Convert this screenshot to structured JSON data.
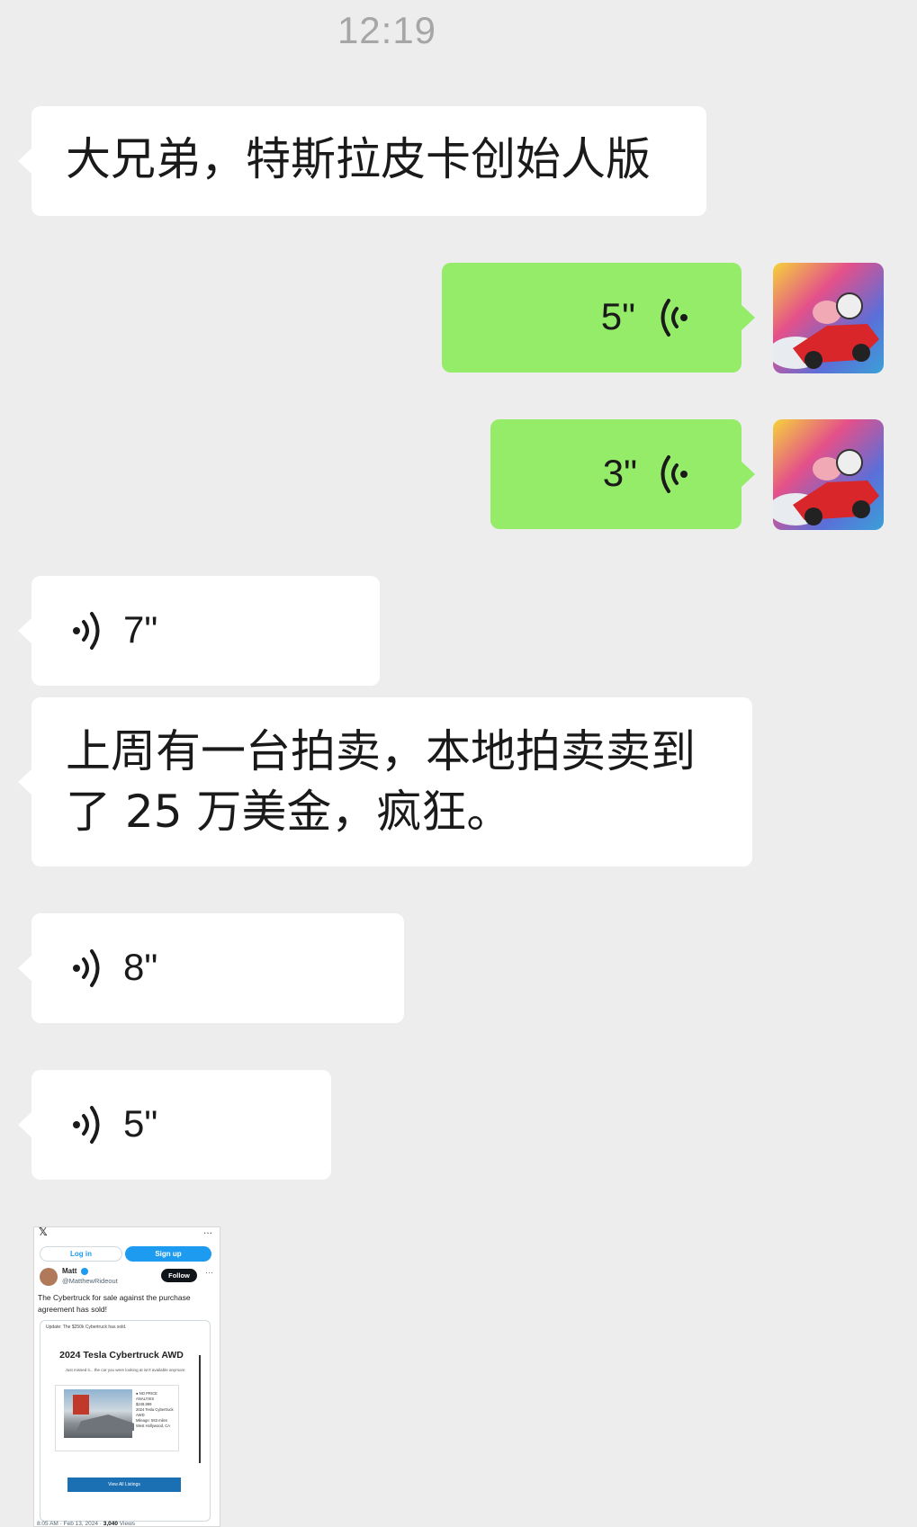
{
  "status": {
    "time": "12:19"
  },
  "messages": {
    "m1": {
      "text": "大兄弟，特斯拉皮卡创始人版"
    },
    "v1": {
      "duration": "5\""
    },
    "v2": {
      "duration": "3\""
    },
    "v3": {
      "duration": "7\""
    },
    "m2": {
      "line1": "上周有一台拍卖，本地拍卖卖到",
      "line2": "了 25 万美金，疯狂。"
    },
    "v4": {
      "duration": "8\""
    },
    "v5": {
      "duration": "5\""
    }
  },
  "screenshot": {
    "x_logo": "𝕏",
    "dots": "...",
    "login": "Log in",
    "signup": "Sign up",
    "user_name": "Matt",
    "user_handle": "@MatthewRideout",
    "follow": "Follow",
    "more": "···",
    "tweet_text": "The Cybertruck for sale against the purchase agreement has sold!",
    "card_update": "Update: The $250k Cybertruck has sold.",
    "card_title": "2024 Tesla Cybertruck AWD",
    "card_sub": "Just missed it... the car you were looking at isn't available anymore",
    "listing_lines": [
      "● NO PRICE ANALYSIS",
      "$249,999",
      "2024 Tesla Cybertruck AWD",
      "Mileage: 553 miles",
      "West Hollywood, CA"
    ],
    "view_all": "View All Listings",
    "meta_time": "8:05 AM · Feb 13, 2024 · ",
    "meta_views": "3,040",
    "meta_views_label": " Views"
  },
  "colors": {
    "background": "#ededed",
    "incoming": "#ffffff",
    "outgoing": "#95ec69"
  }
}
